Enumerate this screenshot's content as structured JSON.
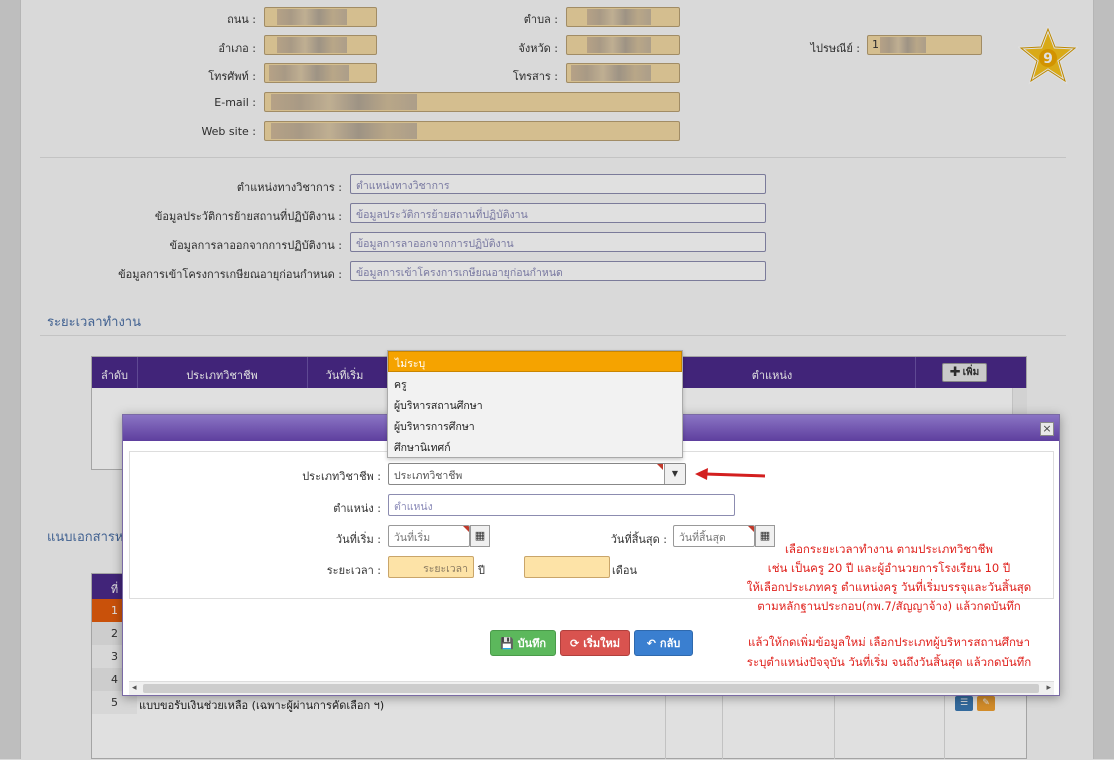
{
  "address": {
    "road_label": "ถนน :",
    "tambon_label": "ตำบล :",
    "amphoe_label": "อำเภอ :",
    "province_label": "จังหวัด :",
    "postcode_label": "ไปรษณีย์ :",
    "postcode_prefix": "1",
    "phone_label": "โทรศัพท์ :",
    "fax_label": "โทรสาร :",
    "email_label": "E-mail :",
    "website_label": "Web site :"
  },
  "academic": {
    "position_label": "ตำแหน่งทางวิชาการ :",
    "position_ph": "ตำแหน่งทางวิชาการ",
    "transfer_label": "ข้อมูลประวัติการย้ายสถานที่ปฏิบัติงาน :",
    "transfer_ph": "ข้อมูลประวัติการย้ายสถานที่ปฏิบัติงาน",
    "leave_label": "ข้อมูลการลาออกจากการปฏิบัติงาน :",
    "leave_ph": "ข้อมูลการลาออกจากการปฏิบัติงาน",
    "early_label": "ข้อมูลการเข้าโครงการเกษียณอายุก่อนกำหนด :",
    "early_ph": "ข้อมูลการเข้าโครงการเกษียณอายุก่อนกำหนด"
  },
  "work_period": {
    "title": "ระยะเวลาทำงาน",
    "col_no": "ลำดับ",
    "col_type": "ประเภทวิชาชีพ",
    "col_start": "วันที่เริ่ม",
    "col_position": "ตำแหน่ง",
    "add_label": "เพิ่ม"
  },
  "attachments": {
    "title": "แนบเอกสารห",
    "col_no": "ที่",
    "rows": [
      "1",
      "2",
      "3",
      "4",
      "5"
    ],
    "row5_text": "แบบขอรับเงินช่วยเหลือ (เฉพาะผู้ผ่านการคัดเลือก ฯ)"
  },
  "dropdown": {
    "options": [
      "ไม่ระบุ",
      "ครู",
      "ผู้บริหารสถานศึกษา",
      "ผู้บริหารการศึกษา",
      "ศึกษานิเทศก์"
    ],
    "selected_index": 0
  },
  "modal": {
    "close_icon": "×",
    "type_label": "ประเภทวิชาชีพ :",
    "type_value": "ประเภทวิชาชีพ",
    "position_label": "ตำแหน่ง :",
    "position_ph": "ตำแหน่ง",
    "start_label": "วันที่เริ่ม :",
    "start_ph": "วันที่เริ่ม",
    "end_label": "วันที่สิ้นสุด :",
    "end_ph": "วันที่สิ้นสุด",
    "duration_label": "ระยะเวลา :",
    "duration_ph": "ระยะเวลา",
    "year_unit": "ปี",
    "month_unit": "เดือน",
    "save_label": "บันทึก",
    "reset_label": "เริ่มใหม่",
    "back_label": "กลับ"
  },
  "notes": {
    "line1": "เลือกระยะเวลาทำงาน ตามประเภทวิชาชีพ",
    "line2": "เช่น เป็นครู 20 ปี และผู้อำนวยการโรงเรียน 10 ปี",
    "line3": "ให้เลือกประเภทครู ตำแหน่งครู วันที่เริ่มบรรจุและวันสิ้นสุด",
    "line4": "ตามหลักฐานประกอบ(กพ.7/สัญญาจ้าง) แล้วกดบันทึก",
    "line5": "แล้วให้กดเพิ่มข้อมูลใหม่ เลือกประเภทผู้บริหารสถานศึกษา",
    "line6": "ระบุตำแหน่งปัจจุบัน วันที่เริ่ม จนถึงวันสิ้นสุด แล้วกดบันทึก"
  },
  "colors": {
    "header_purple": "#4b2a8a",
    "dropdown_selected": "#f5a300",
    "note_red": "#e0211c",
    "arrow_red": "#d31f1f"
  },
  "icons": {
    "star_badge": "star-9-icon",
    "calendar": "calendar-icon",
    "save": "floppy-icon",
    "reset": "refresh-icon",
    "back": "reply-icon",
    "add": "plus-icon",
    "view": "list-icon",
    "edit": "pencil-icon"
  }
}
